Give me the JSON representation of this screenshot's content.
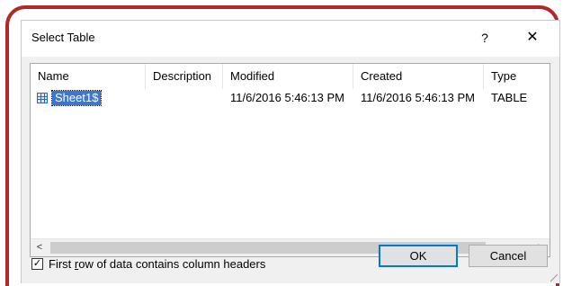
{
  "dialog": {
    "title": "Select Table",
    "help_glyph": "?",
    "close_glyph": "✕"
  },
  "columns": [
    "Name",
    "Description",
    "Modified",
    "Created",
    "Type"
  ],
  "rows": [
    {
      "name": "Sheet1$",
      "description": "",
      "modified": "11/6/2016 5:46:13 PM",
      "created": "11/6/2016 5:46:13 PM",
      "type": "TABLE",
      "icon": "table-icon"
    }
  ],
  "scrollbar": {
    "left_arrow": "<",
    "right_arrow": ">"
  },
  "checkbox": {
    "label_pre": "First ",
    "label_underlined": "r",
    "label_post": "ow of data contains column headers",
    "checked": true,
    "check_glyph": "✓"
  },
  "buttons": {
    "ok": "OK",
    "cancel": "Cancel"
  },
  "colors": {
    "frame": "#b5262b",
    "selection": "#3a76d3",
    "ok_border": "#0078d7"
  }
}
